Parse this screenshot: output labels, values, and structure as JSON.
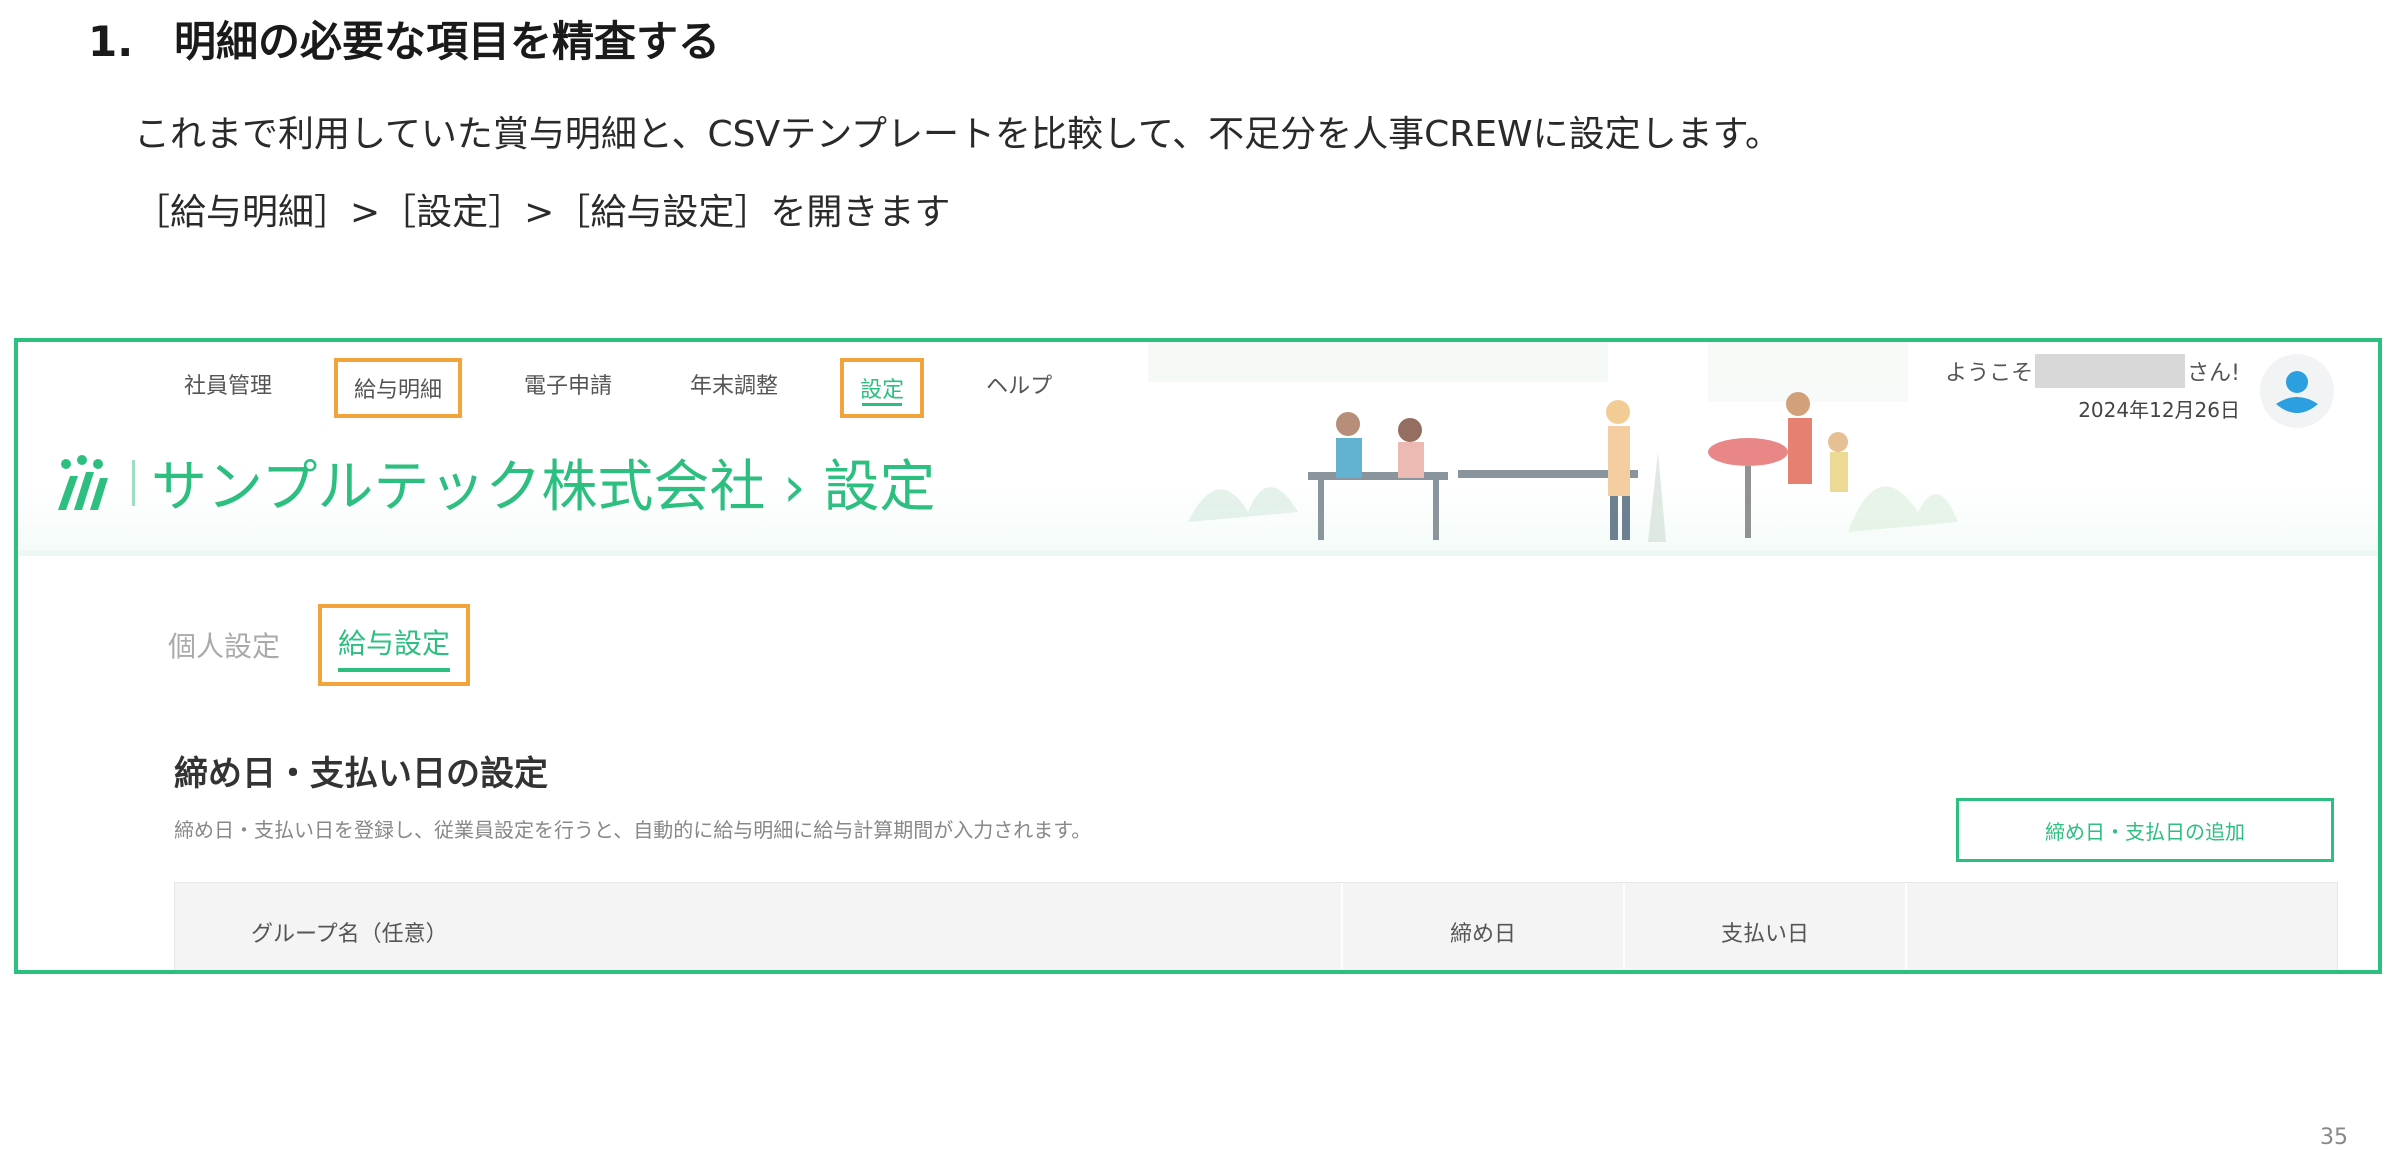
{
  "document": {
    "heading_number": "1.",
    "heading_text": "明細の必要な項目を精査する",
    "line1": "これまで利用していた賞与明細と、CSVテンプレートを比較して、不足分を人事CREWに設定します。",
    "line2": "［給与明細］>［設定］>［給与設定］を開きます",
    "page_number": "35"
  },
  "app": {
    "nav": [
      {
        "label": "社員管理"
      },
      {
        "label": "給与明細",
        "highlighted": true
      },
      {
        "label": "電子申請"
      },
      {
        "label": "年末調整"
      },
      {
        "label": "設定",
        "highlighted": true,
        "active": true
      },
      {
        "label": "ヘルプ"
      }
    ],
    "brand_title": "サンプルテック株式会社 › 設定",
    "welcome_prefix": "ようこそ",
    "welcome_suffix": "さん!",
    "date": "2024年12月26日",
    "tabs": [
      {
        "label": "個人設定"
      },
      {
        "label": "給与設定",
        "highlighted": true,
        "active": true
      }
    ],
    "section_title": "締め日・支払い日の設定",
    "section_desc": "締め日・支払い日を登録し、従業員設定を行うと、自動的に給与明細に給与計算期間が入力されます。",
    "add_button": "締め日・支払日の追加",
    "table_headers": [
      "グループ名（任意）",
      "締め日",
      "支払い日",
      ""
    ]
  },
  "colors": {
    "accent": "#2cbf7f",
    "highlight_box": "#f2a33a"
  }
}
